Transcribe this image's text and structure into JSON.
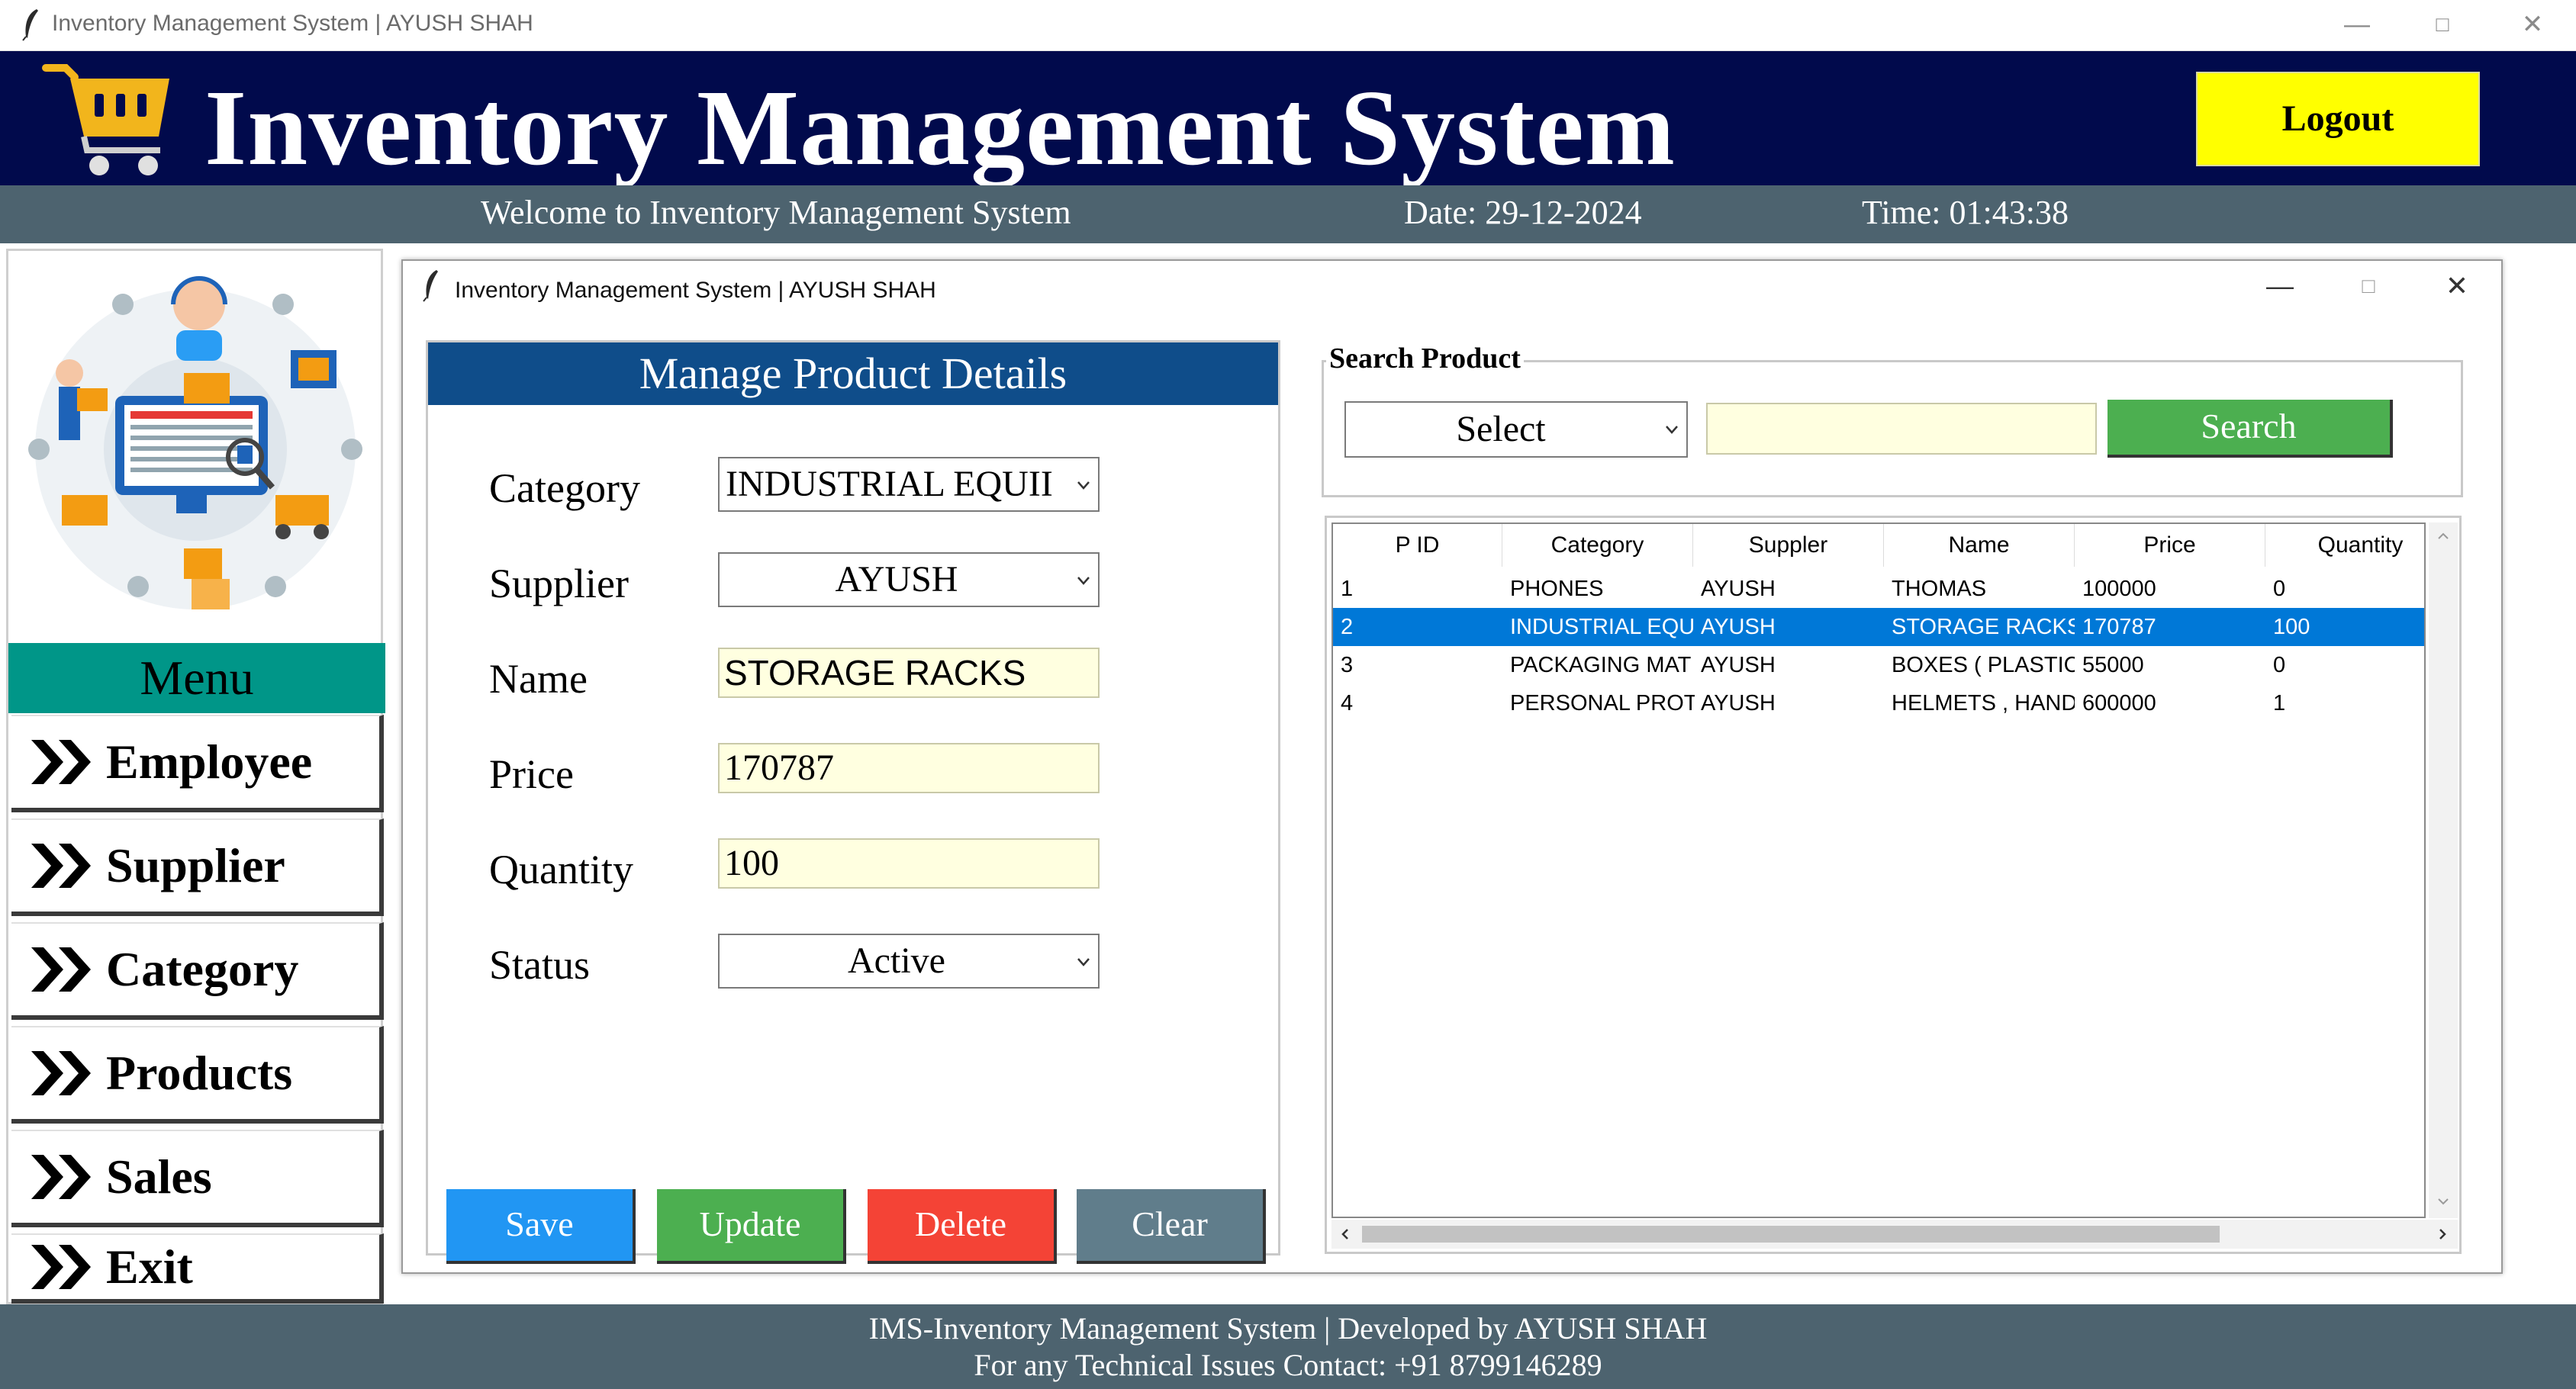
{
  "window": {
    "title": "Inventory Management System | AYUSH SHAH",
    "controls": [
      "minimize-icon",
      "maximize-icon",
      "close-icon"
    ]
  },
  "header": {
    "title": "Inventory Management System",
    "logout_label": "Logout",
    "colors": {
      "background": "#010a4c",
      "logout_bg": "#ffff00"
    }
  },
  "subheader": {
    "welcome": "Welcome to Inventory Management System",
    "date": "Date: 29-12-2024",
    "time": "Time: 01:43:38"
  },
  "sidebar": {
    "menu_title": "Menu",
    "items": [
      {
        "label": "Employee"
      },
      {
        "label": "Supplier"
      },
      {
        "label": "Category"
      },
      {
        "label": "Products"
      },
      {
        "label": "Sales"
      },
      {
        "label": "Exit"
      }
    ],
    "colors": {
      "menu_title_bg": "#009688"
    }
  },
  "product_window": {
    "title": "Inventory Management System | AYUSH SHAH",
    "form": {
      "title": "Manage Product Details",
      "fields": {
        "category": {
          "label": "Category",
          "value": "INDUSTRIAL EQUII"
        },
        "supplier": {
          "label": "Supplier",
          "value": "AYUSH"
        },
        "name": {
          "label": "Name",
          "value": "STORAGE RACKS"
        },
        "price": {
          "label": "Price",
          "value": "170787"
        },
        "quantity": {
          "label": "Quantity",
          "value": "100"
        },
        "status": {
          "label": "Status",
          "value": "Active"
        }
      },
      "buttons": {
        "save": "Save",
        "update": "Update",
        "delete": "Delete",
        "clear": "Clear"
      },
      "colors": {
        "title_bg": "#0f4d8a",
        "save": "#2196f3",
        "update": "#4caf50",
        "delete": "#f44336",
        "clear": "#607d8b"
      }
    },
    "search": {
      "legend": "Search Product",
      "select_value": "Select",
      "input_value": "",
      "button_label": "Search"
    },
    "table": {
      "columns": [
        "P ID",
        "Category",
        "Suppler",
        "Name",
        "Price",
        "Quantity"
      ],
      "rows": [
        [
          "1",
          "PHONES",
          "AYUSH",
          "THOMAS",
          "100000",
          "0"
        ],
        [
          "2",
          "INDUSTRIAL EQUI",
          "AYUSH",
          "STORAGE RACKS",
          "170787",
          "100"
        ],
        [
          "3",
          "PACKAGING MAT",
          "AYUSH",
          "BOXES ( PLASTIC)",
          "55000",
          "0"
        ],
        [
          "4",
          "PERSONAL PROTI",
          "AYUSH",
          "HELMETS , HAND",
          "600000",
          "1"
        ]
      ],
      "selected_row_index": 1,
      "colors": {
        "selection": "#0078d7"
      }
    }
  },
  "footer": {
    "line1": "IMS-Inventory Management System | Developed by AYUSH SHAH",
    "line2": "For any Technical Issues Contact: +91 8799146289"
  }
}
